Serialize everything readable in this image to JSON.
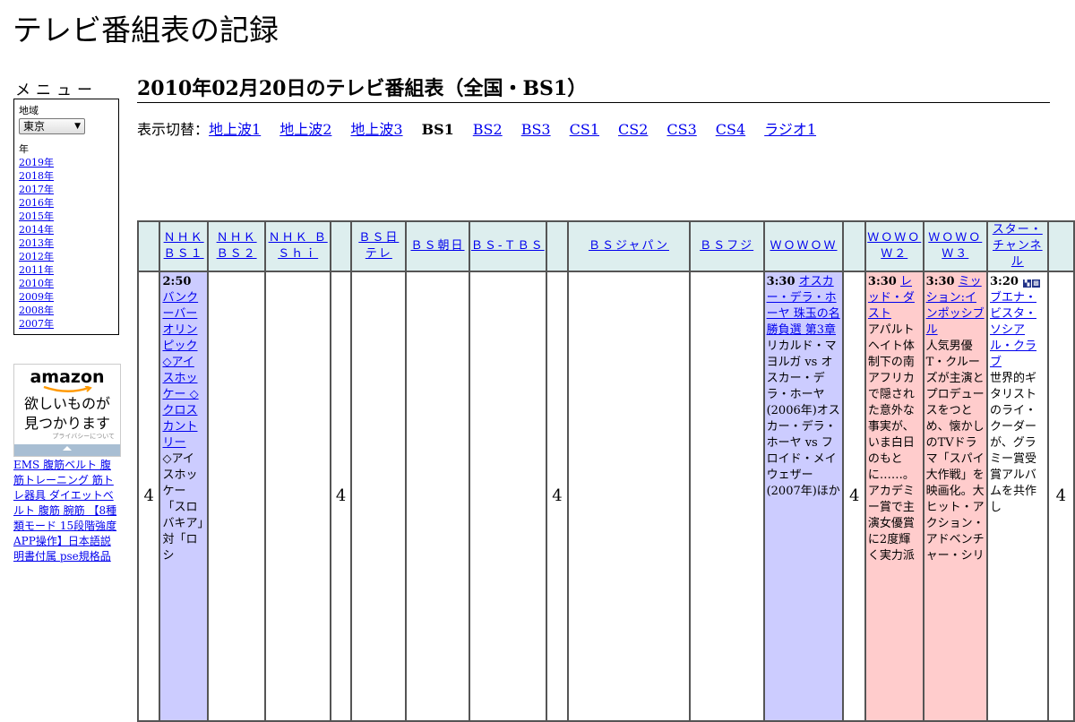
{
  "site": {
    "title": "テレビ番組表の記録"
  },
  "menu": {
    "heading": "メニュー",
    "region_label": "地域",
    "region_value": "東京",
    "year_label": "年",
    "years": [
      "2019年",
      "2018年",
      "2017年",
      "2016年",
      "2015年",
      "2014年",
      "2013年",
      "2012年",
      "2011年",
      "2010年",
      "2009年",
      "2008年",
      "2007年"
    ]
  },
  "ad": {
    "logo": "amazon",
    "line1": "欲しいものが",
    "line2": "見つかります",
    "privacy": "プライバシーについて",
    "links_text": "EMS 腹筋ベルト 腹筋トレーニング 筋トレ器具 ダイエットベルト 腹筋 腕筋 【8種類モード 15段階強度 APP操作】日本語説明書付属 pse規格品"
  },
  "main": {
    "heading": "2010年02月20日のテレビ番組表（全国・BS1）",
    "switch_label": "表示切替：",
    "switch_items": [
      {
        "label": "地上波1",
        "current": false
      },
      {
        "label": "地上波2",
        "current": false
      },
      {
        "label": "地上波3",
        "current": false
      },
      {
        "label": "BS1",
        "current": true
      },
      {
        "label": "BS2",
        "current": false
      },
      {
        "label": "BS3",
        "current": false
      },
      {
        "label": "CS1",
        "current": false
      },
      {
        "label": "CS2",
        "current": false
      },
      {
        "label": "CS3",
        "current": false
      },
      {
        "label": "CS4",
        "current": false
      },
      {
        "label": "ラジオ1",
        "current": false
      }
    ]
  },
  "guide": {
    "hour": "4",
    "channels": {
      "nhk_bs1": "ＮＨＫ ＢＳ１",
      "nhk_bs2": "ＮＨＫ ＢＳ２",
      "nhk_bshi": "ＮＨＫ ＢＳｈｉ",
      "bs_ntv": "ＢＳ日テレ",
      "bs_asahi": "ＢＳ朝日",
      "bs_tbs": "ＢＳ-ＴＢＳ",
      "bs_japan": "ＢＳジャパン",
      "bs_fuji": "ＢＳフジ",
      "wowow": "ＷＯＷＯＷ",
      "wowow2": "ＷＯＷＯＷ２",
      "wowow3": "ＷＯＷＯＷ３",
      "star": "スター・チャンネル"
    },
    "programs": {
      "nhk_bs1": {
        "time": "2:50",
        "title": "バンクーバーオリンピック ◇アイスホッケー ◇クロスカントリー",
        "desc": "◇アイスホッケー「スロバキア」対「ロシ"
      },
      "wowow": {
        "time": "3:30",
        "title": "オスカー・デラ・ホーヤ 珠玉の名勝負選 第3章",
        "desc": "リカルド・マヨルガ vs オスカー・デラ・ホーヤ(2006年)オスカー・デラ・ホーヤ vs フロイド・メイウェザー(2007年)ほか"
      },
      "wowow2": {
        "time": "3:30",
        "title": "レッド・ダスト",
        "desc": "アパルトヘイト体制下の南アフリカで隠された意外な事実が、いま白日のもとに……。アカデミー賞で主演女優賞に2度輝く実力派"
      },
      "wowow3": {
        "time": "3:30",
        "title": "ミッション:インポッシブル",
        "desc": "人気男優T・クルーズが主演とプロデュースをつとめ、懐かしのTVドラマ「スパイ大作戦」を映画化。大ヒット・アクション・アドベンチャー・シリ"
      },
      "star": {
        "time": "3:20",
        "title": "ブエナ・ビスタ・ソシアル・クラブ",
        "desc": "世界的ギタリストのライ・クーダーが、グラミー賞受賞アルバムを共作し"
      }
    }
  },
  "colors": {
    "header_bg": "#ddeeee",
    "blue_cell": "#ccccff",
    "pink_cell": "#ffcccc",
    "link": "#0000ee"
  }
}
